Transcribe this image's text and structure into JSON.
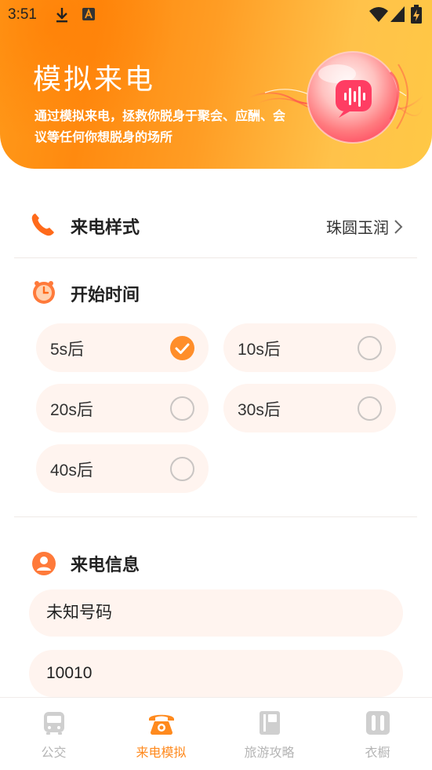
{
  "status_bar": {
    "time": "3:51"
  },
  "hero": {
    "title": "模拟来电",
    "description": "通过模拟来电，拯救你脱身于聚会、应酬、会议等任何你想脱身的场所"
  },
  "call_style": {
    "title": "来电样式",
    "value": "珠圆玉润"
  },
  "start_time": {
    "title": "开始时间",
    "options": [
      {
        "label": "5s后",
        "selected": true
      },
      {
        "label": "10s后",
        "selected": false
      },
      {
        "label": "20s后",
        "selected": false
      },
      {
        "label": "30s后",
        "selected": false
      },
      {
        "label": "40s后",
        "selected": false
      }
    ]
  },
  "call_info": {
    "title": "来电信息",
    "name_value": "未知号码",
    "number_value": "10010"
  },
  "tabbar": {
    "items": [
      {
        "label": "公交",
        "icon": "bus-icon",
        "active": false
      },
      {
        "label": "来电模拟",
        "icon": "telephone-icon",
        "active": true
      },
      {
        "label": "旅游攻略",
        "icon": "book-icon",
        "active": false
      },
      {
        "label": "衣橱",
        "icon": "wardrobe-icon",
        "active": false
      }
    ]
  },
  "colors": {
    "accent": "#ff8a1e",
    "option_bg": "#fff4ef",
    "hero_start": "#ff8a0f",
    "hero_end": "#ffc845"
  }
}
